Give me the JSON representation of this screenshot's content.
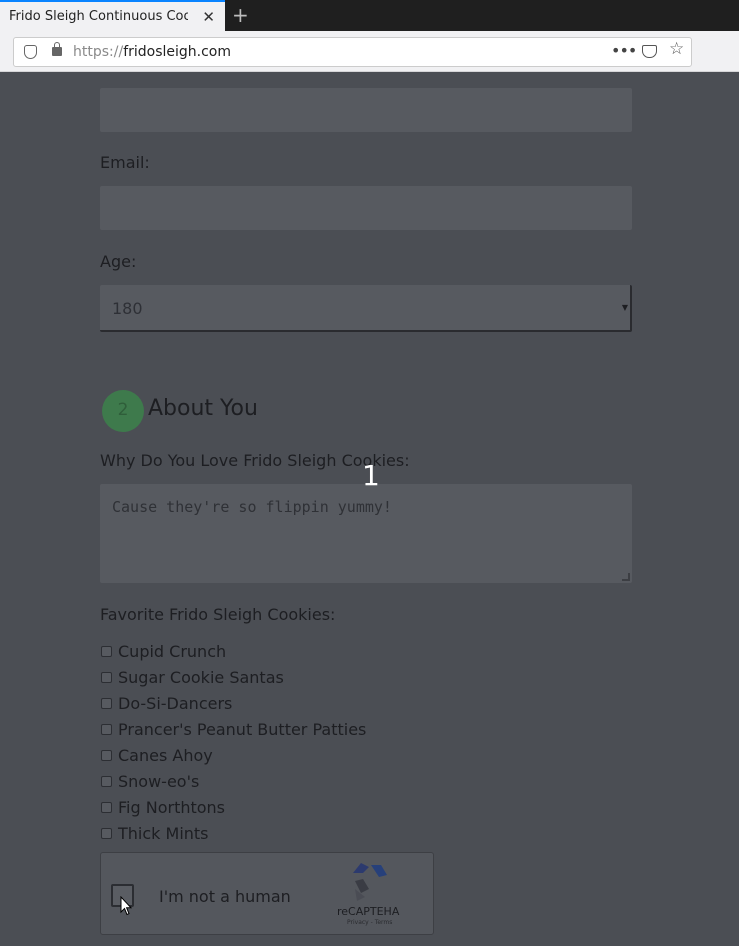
{
  "browser": {
    "tab_title": "Frido Sleigh Continuous Coo",
    "tab_close_icon": "close-icon",
    "new_tab_icon": "plus-icon",
    "url_scheme": "https://",
    "url_host": "fridosleigh.com",
    "page_actions_icon": "more-icon",
    "pocket_icon": "pocket-icon",
    "bookmark_icon": "star-icon",
    "accent": "#0a84ff"
  },
  "form": {
    "email_label": "Email:",
    "age_label": "Age:",
    "age_value": "180",
    "section_number": "2",
    "section_title": "About You",
    "why_label": "Why Do You Love Frido Sleigh Cookies:",
    "why_placeholder": "Cause they're so flippin yummy!",
    "favorites_label": "Favorite Frido Sleigh Cookies:",
    "cookies": [
      "Cupid Crunch",
      "Sugar Cookie Santas",
      "Do-Si-Dancers",
      "Prancer's Peanut Butter Patties",
      "Canes Ahoy",
      "Snow-eo's",
      "Fig Northtons",
      "Thick Mints"
    ]
  },
  "overlay": {
    "number": "1"
  },
  "captcha": {
    "label": "I'm not a human",
    "brand": "reCAPTEHA",
    "sub": "Privacy - Terms"
  }
}
